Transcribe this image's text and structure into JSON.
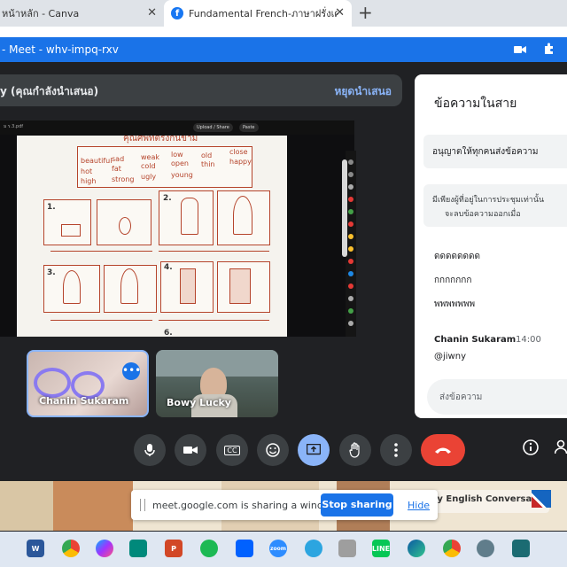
{
  "browser": {
    "tabs": [
      {
        "label": "หน้าหลัก - Canva"
      },
      {
        "label": "Fundamental French-ภาษาฝรั่งเศส",
        "icon": "facebook-icon"
      }
    ],
    "close_glyph": "✕",
    "new_tab_glyph": "+"
  },
  "meet": {
    "window_title": "- Meet - whv-impq-rxv",
    "presenter_label": "y (คุณกำลังนำเสนอ)",
    "stop_presenting": "หยุดนำเสนอ",
    "shared_toolbar": {
      "upload_share": "Upload / Share",
      "paste": "Paste"
    },
    "worksheet": {
      "title": "คุณศัพท์ตรงกันข้าม",
      "words": [
        "beautiful",
        "sad",
        "weak",
        "low",
        "old",
        "close",
        "hot",
        "fat",
        "cold",
        "open",
        "thin",
        "happy",
        "high",
        "strong",
        "ugly",
        "young"
      ],
      "numbers": [
        "1.",
        "2.",
        "3.",
        "4.",
        "5.",
        "6."
      ]
    },
    "participants": [
      {
        "name": "Chanin Sukaram"
      },
      {
        "name": "Bowy Lucky"
      }
    ],
    "chat": {
      "title": "ข้อความในสาย",
      "allow_label": "อนุญาตให้ทุกคนส่งข้อความ",
      "note_line1": "มีเพียงผู้ที่อยู่ในการประชุมเท่านั้น",
      "note_line2": "จะลบข้อความออกเมื่อ",
      "messages": [
        "ดดดดดดดด",
        "กกกกกกก",
        "พพพพพพพ"
      ],
      "sender": "Chanin Sukaram",
      "time": "14:00",
      "last_message": "@jiwny",
      "compose_placeholder": "ส่งข้อความ"
    },
    "controls": [
      "mic-icon",
      "camera-icon",
      "captions-icon",
      "emoji-icon",
      "present-icon",
      "raise-hand-icon",
      "more-icon",
      "end-call-icon"
    ],
    "captions_label": "CC"
  },
  "sharing_bar": {
    "message": "meet.google.com is sharing a window.",
    "stop_label": "Stop sharing",
    "hide_label": "Hide"
  },
  "background_ad": "ly English Conversation",
  "taskbar_apps": [
    "word",
    "chrome",
    "messenger",
    "meet",
    "powerpoint",
    "spotify",
    "dropbox",
    "zoom",
    "telegram",
    "mic",
    "line",
    "edge",
    "chrome-profile",
    "settings",
    "clipchamp"
  ],
  "colors": {
    "accent": "#1a73e8",
    "leave": "#ea4335",
    "present": "#8ab4f8"
  }
}
